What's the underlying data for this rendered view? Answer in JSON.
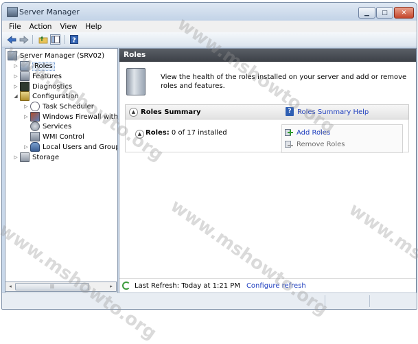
{
  "window": {
    "title": "Server Manager",
    "controls": [
      "minimize",
      "maximize",
      "close"
    ]
  },
  "menubar": {
    "items": [
      "File",
      "Action",
      "View",
      "Help"
    ]
  },
  "toolbar": {
    "icons": [
      "back-arrow-icon",
      "forward-arrow-icon",
      "up-folder-icon",
      "show-hide-tree-icon",
      "help-icon"
    ]
  },
  "tree": {
    "root": "Server Manager (SRV02)",
    "items": [
      {
        "label": "Roles",
        "expander": "▷",
        "selected": true
      },
      {
        "label": "Features",
        "expander": "▷"
      },
      {
        "label": "Diagnostics",
        "expander": "▷"
      },
      {
        "label": "Configuration",
        "expander": "◢"
      },
      {
        "label": "Task Scheduler",
        "expander": "▷"
      },
      {
        "label": "Windows Firewall with A",
        "expander": "▷"
      },
      {
        "label": "Services",
        "expander": ""
      },
      {
        "label": "WMI Control",
        "expander": ""
      },
      {
        "label": "Local Users and Groups",
        "expander": "▷"
      },
      {
        "label": "Storage",
        "expander": "▷"
      }
    ],
    "scroll_left": "◂",
    "scroll_right": "▸",
    "scroll_grip": "|||"
  },
  "main": {
    "header": "Roles",
    "intro": "View the health of the roles installed on your server and add or remove roles and features.",
    "summary": {
      "title": "Roles Summary",
      "help_link": "Roles Summary Help",
      "roles_label": "Roles:",
      "roles_value": "0 of 17 installed",
      "add_roles": "Add Roles",
      "remove_roles": "Remove Roles"
    },
    "status": {
      "last_refresh": "Last Refresh: Today at 1:21 PM",
      "configure_refresh": "Configure refresh"
    }
  },
  "watermark": "www.mshowto.org",
  "colors": {
    "header_bg": "#4a4e55",
    "link": "#1f3fbf",
    "titlebar": "#c9d8ea"
  }
}
